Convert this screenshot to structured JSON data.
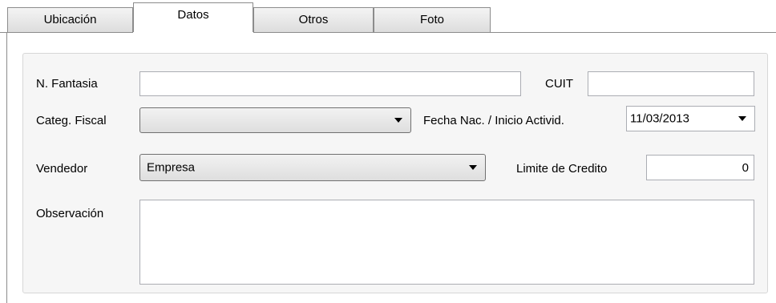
{
  "tabs": [
    {
      "label": "Ubicación",
      "active": false
    },
    {
      "label": "Datos",
      "active": true
    },
    {
      "label": "Otros",
      "active": false
    },
    {
      "label": "Foto",
      "active": false
    }
  ],
  "form": {
    "fantasia": {
      "label": "N. Fantasia",
      "value": ""
    },
    "cuit": {
      "label": "CUIT",
      "value": ""
    },
    "categ_fiscal": {
      "label": "Categ. Fiscal",
      "value": ""
    },
    "fecha": {
      "label": "Fecha Nac. / Inicio Activid.",
      "value": "11/03/2013"
    },
    "vendedor": {
      "label": "Vendedor",
      "value": "Empresa"
    },
    "limite": {
      "label": "Limite de Credito",
      "value": "0"
    },
    "observacion": {
      "label": "Observación",
      "value": ""
    }
  },
  "colors": {
    "tab_border": "#8c8c8c",
    "panel_bg": "#f6f6f6",
    "input_border": "#abadb3"
  }
}
